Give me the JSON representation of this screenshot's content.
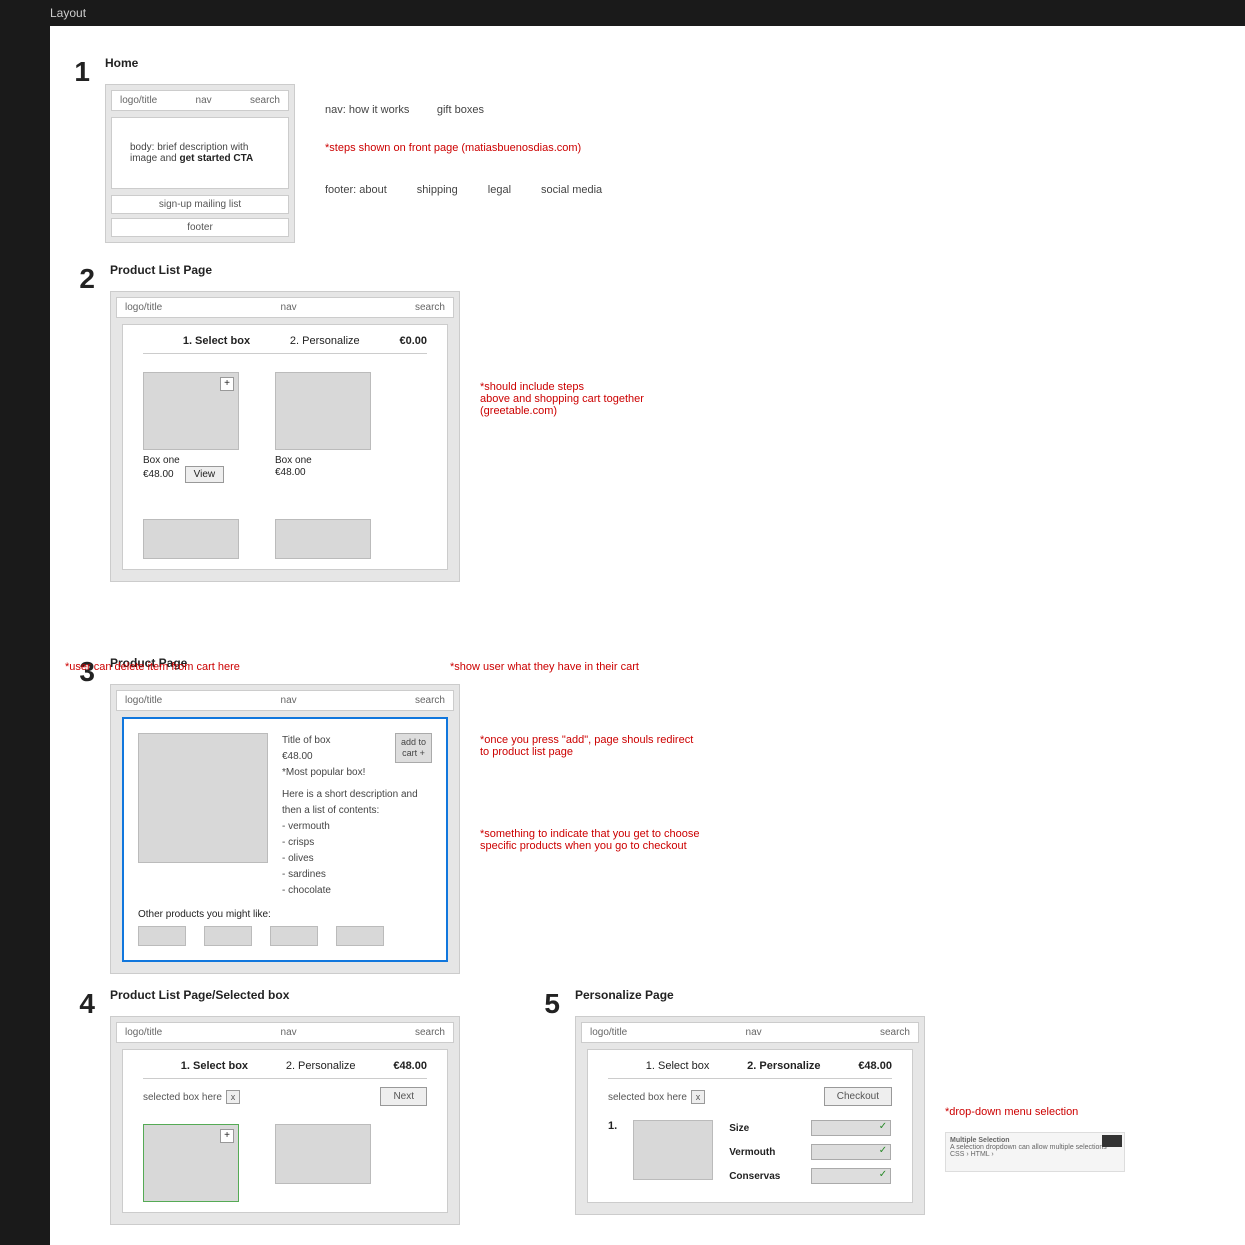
{
  "topbar": "Layout",
  "sections": {
    "s1": {
      "num": "1",
      "title": "Home",
      "hdr": {
        "logo": "logo/title",
        "nav": "nav",
        "search": "search"
      },
      "body_line1": "body: brief description with image and ",
      "body_cta": "get started CTA",
      "signup": "sign-up mailing list",
      "footer_label": "footer",
      "nav_note": "nav: how it works         gift boxes",
      "red_note": "*steps shown on front page (matiasbuenosdias.com)",
      "footer_items": [
        "footer: about",
        "shipping",
        "legal",
        "social media"
      ]
    },
    "s2": {
      "num": "2",
      "title": "Product List Page",
      "step1": "1. Select box",
      "step2": "2. Personalize",
      "total": "€0.00",
      "p1_name": "Box one",
      "p1_price": "€48.00",
      "p1_btn": "View",
      "p2_name": "Box one",
      "p2_price": "€48.00",
      "annot": "*should include steps\nabove and shopping cart together\n(greetable.com)"
    },
    "s3": {
      "num": "3",
      "title": "Product Page",
      "box_title": "Title of box",
      "price": "€48.00",
      "tag": "*Most popular box!",
      "desc": "Here is a short description and then a list of contents:",
      "items": [
        "- vermouth",
        "- crisps",
        "- olives",
        "- sardines",
        "- chocolate"
      ],
      "addcart": "add to\ncart +",
      "other": "Other products you might like:",
      "annot1": "*once you press \"add\", page shouls redirect to product list page",
      "annot2": "*something to indicate that you get to choose specific products when you go to checkout"
    },
    "s4": {
      "num": "4",
      "title": "Product List Page/Selected box",
      "step1": "1. Select box",
      "step2": "2. Personalize",
      "total": "€48.00",
      "selected": "selected box here",
      "next": "Next",
      "annot_left": "*user can delete item from cart here",
      "annot_right": "*show user what they have in their cart"
    },
    "s5": {
      "num": "5",
      "title": "Personalize Page",
      "step1": "1. Select box",
      "step2": "2. Personalize",
      "total": "€48.00",
      "selected": "selected box here",
      "checkout": "Checkout",
      "list_num": "1.",
      "opts": [
        "Size",
        "Vermouth",
        "Conservas"
      ],
      "annot": "*drop-down menu selection",
      "mshot_title": "Multiple Selection",
      "mshot_sub": "A selection dropdown can allow multiple selections",
      "mshot_tags": "CSS ›   HTML ›"
    }
  }
}
